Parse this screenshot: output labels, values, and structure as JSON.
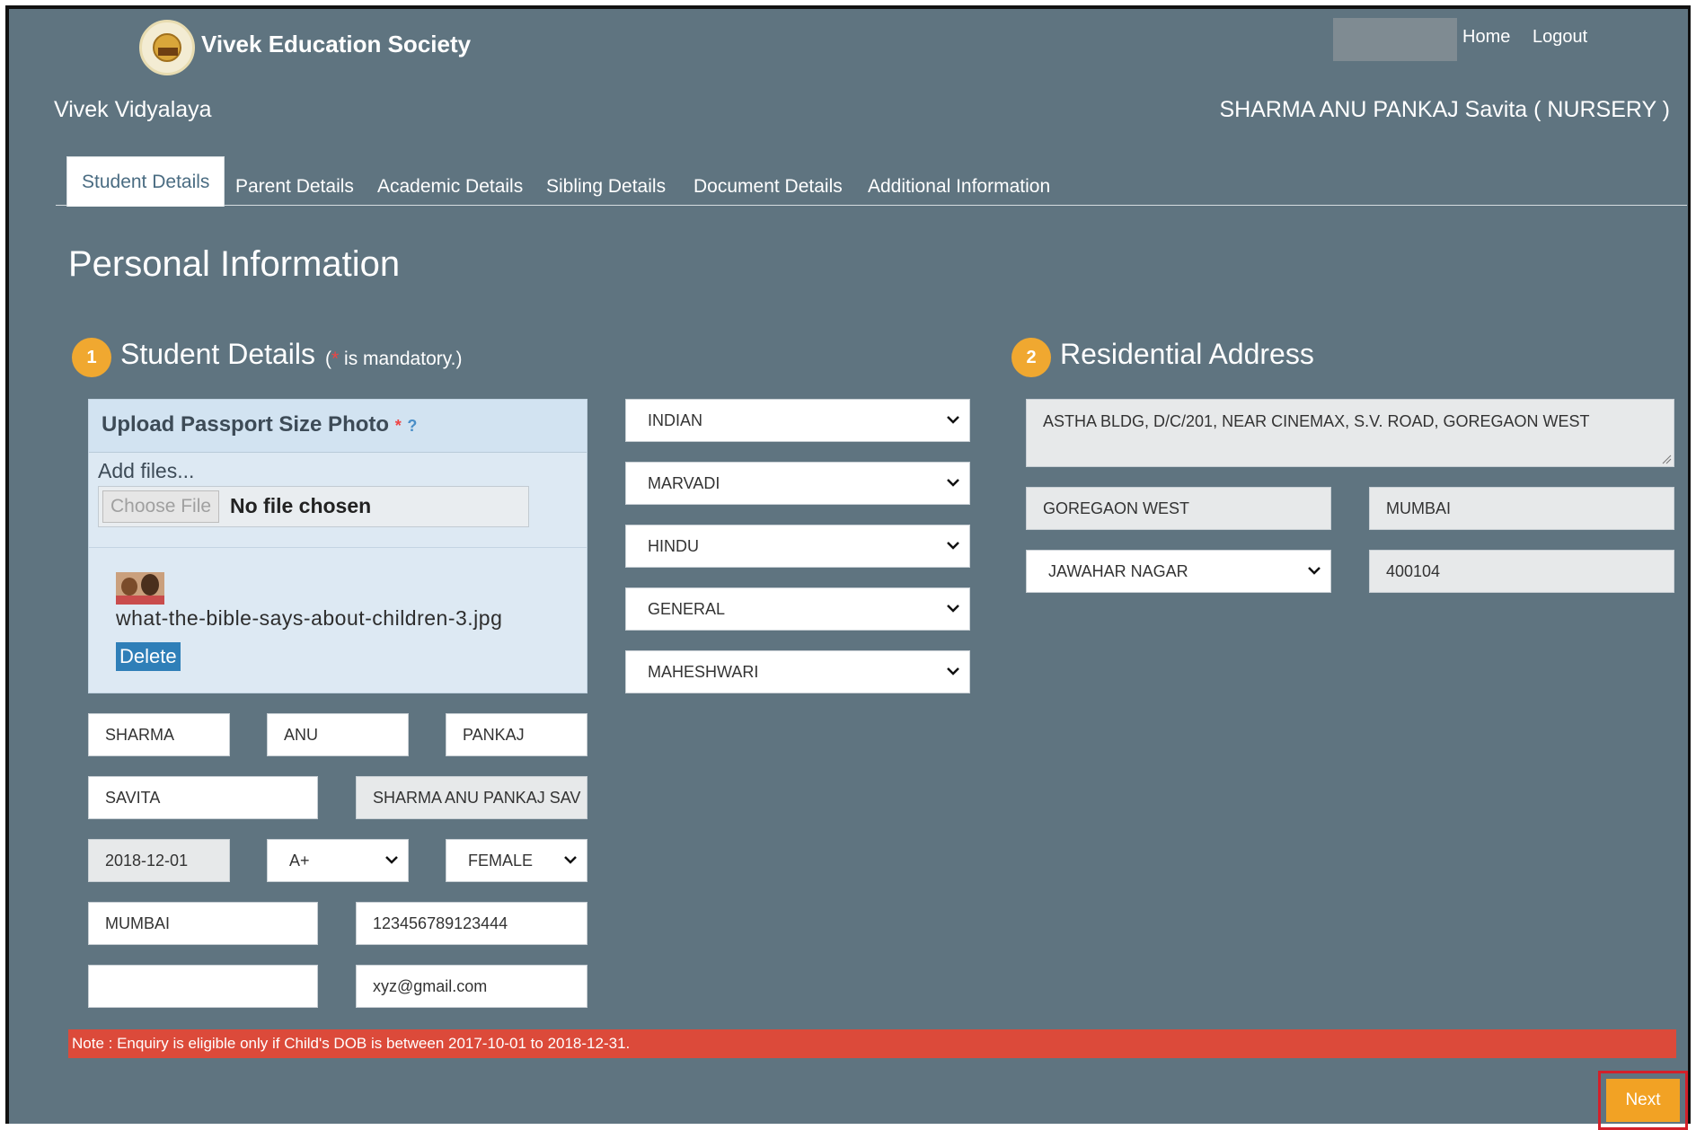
{
  "header": {
    "brand": "Vivek Education Society",
    "home_link": "Home",
    "logout_link": "Logout",
    "school": "Vivek Vidyalaya",
    "student_label": "SHARMA ANU PANKAJ Savita ( NURSERY )"
  },
  "tabs": [
    {
      "label": "Student Details",
      "active": true
    },
    {
      "label": "Parent Details"
    },
    {
      "label": "Academic Details"
    },
    {
      "label": "Sibling Details"
    },
    {
      "label": "Document Details"
    },
    {
      "label": "Additional Information"
    }
  ],
  "page_title": "Personal Information",
  "student_section": {
    "step": "1",
    "title": "Student Details",
    "mandatory_open": "(",
    "mandatory_star": "*",
    "mandatory_text": " is mandatory.)",
    "upload": {
      "title": "Upload Passport Size Photo",
      "star": "*",
      "help": "?",
      "add_files": "Add files...",
      "choose_file": "Choose File",
      "no_file": "No file chosen",
      "uploaded_name": "what-the-bible-says-about-children-3.jpg",
      "delete": "Delete"
    },
    "fields": {
      "surname": "SHARMA",
      "first_name": "ANU",
      "middle_name": "PANKAJ",
      "mother_name": "SAVITA",
      "full_name": "SHARMA ANU PANKAJ SAV",
      "dob": "2018-12-01",
      "blood_group": "A+",
      "gender": "FEMALE",
      "birth_place": "MUMBAI",
      "aadhar": "123456789123444",
      "empty_field": "",
      "email": "xyz@gmail.com"
    },
    "selects": {
      "nationality": "INDIAN",
      "mother_tongue": "MARVADI",
      "religion": "HINDU",
      "category": "GENERAL",
      "caste": "MAHESHWARI"
    }
  },
  "address_section": {
    "step": "2",
    "title": "Residential Address",
    "address": "ASTHA BLDG, D/C/201, NEAR CINEMAX, S.V. ROAD, GOREGAON WEST",
    "area": "GOREGAON WEST",
    "city": "MUMBAI",
    "locality": "JAWAHAR NAGAR",
    "pincode": "400104"
  },
  "note": "Note : Enquiry is eligible only if Child's DOB is between 2017-10-01 to 2018-12-31.",
  "next_button": "Next",
  "colors": {
    "background": "#5f7480",
    "accent": "#f0a830",
    "note_red": "#dc4a3a",
    "delete_blue": "#2f7fb8"
  }
}
